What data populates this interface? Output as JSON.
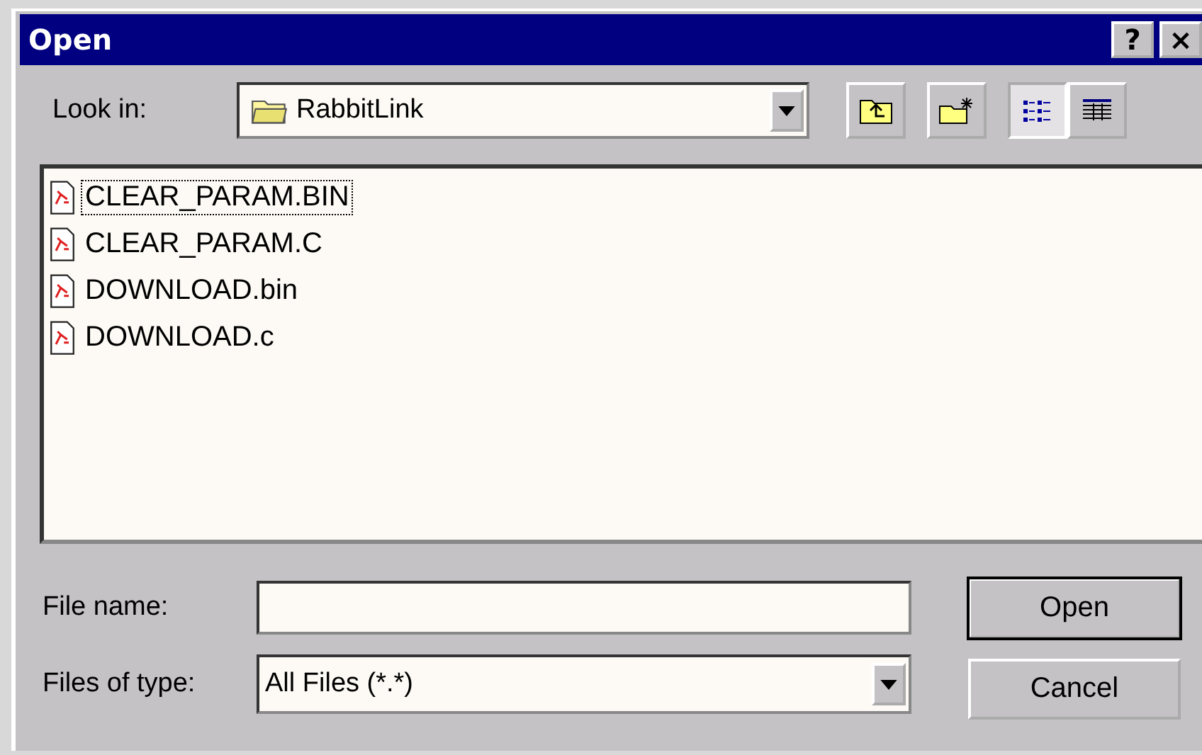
{
  "window": {
    "title": "Open",
    "help_button": "?",
    "close_button": "×"
  },
  "look_in": {
    "label": "Look in:",
    "value": "RabbitLink"
  },
  "toolbar": [
    {
      "kind": "up",
      "pressed": false
    },
    {
      "kind": "new-folder",
      "pressed": false
    },
    {
      "kind": "list",
      "pressed": true
    },
    {
      "kind": "details",
      "pressed": false
    }
  ],
  "files": [
    {
      "name": "CLEAR_PARAM.BIN",
      "focused": true
    },
    {
      "name": "CLEAR_PARAM.C",
      "focused": false
    },
    {
      "name": "DOWNLOAD.bin",
      "focused": false
    },
    {
      "name": "DOWNLOAD.c",
      "focused": false
    }
  ],
  "file_name": {
    "label": "File name:"
  },
  "file_type": {
    "label": "Files of type:",
    "value": "All Files (*.*)"
  },
  "buttons": [
    {
      "label": "Open",
      "default": true
    },
    {
      "label": "Cancel",
      "default": false
    }
  ]
}
